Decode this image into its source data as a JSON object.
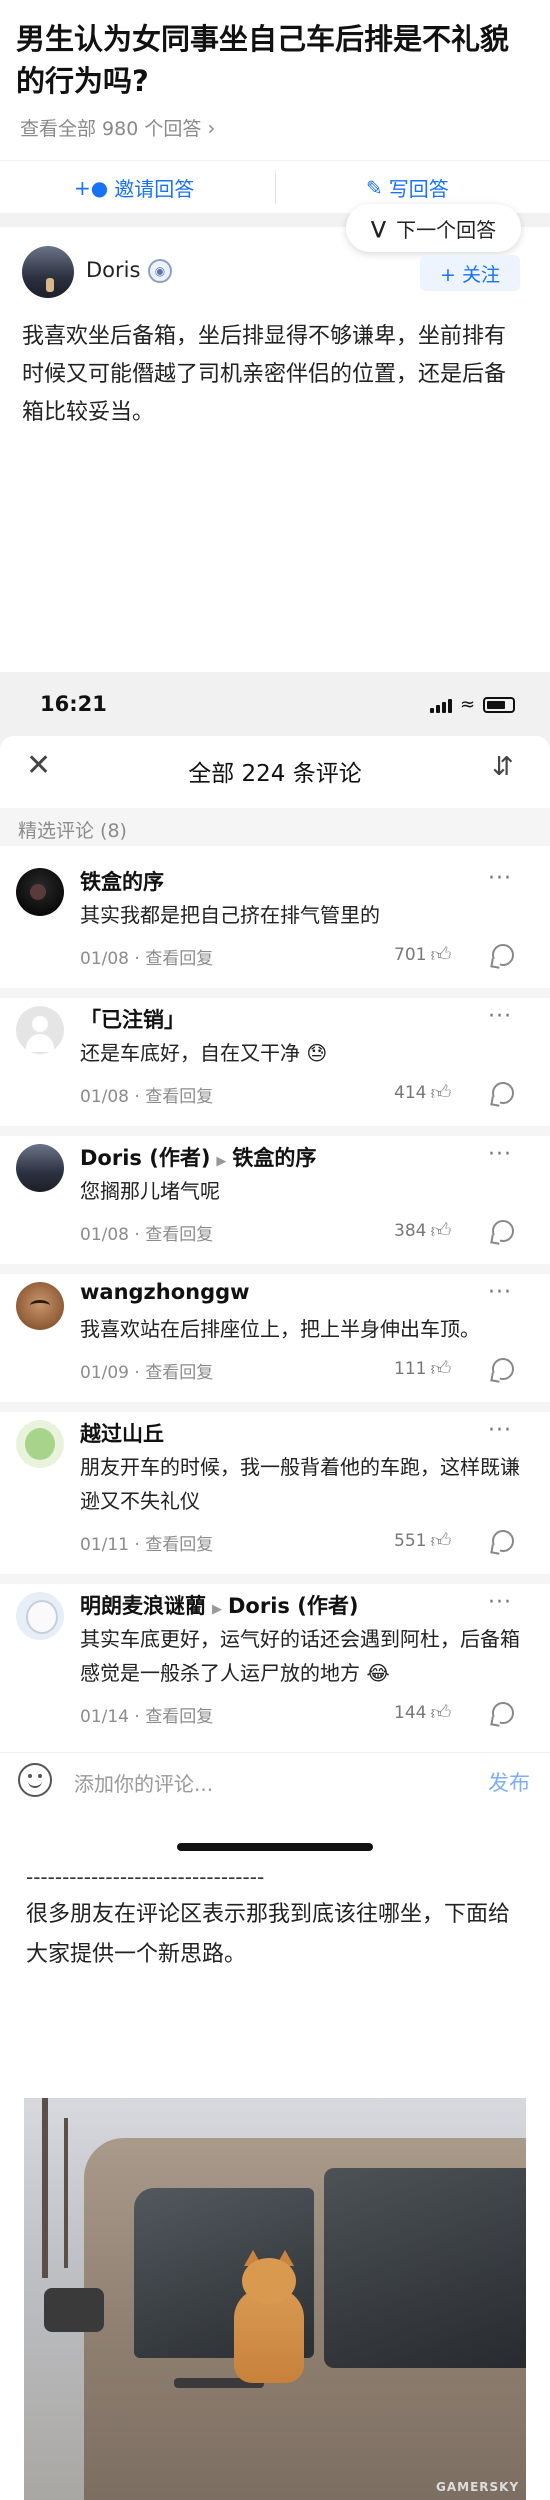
{
  "question": {
    "title": "男生认为女同事坐自己车后排是不礼貌的行为吗?",
    "view_all": "查看全部 980 个回答",
    "invite_label": "邀请回答",
    "write_label": "写回答",
    "next_answer_label": "下一个回答"
  },
  "answer": {
    "author": "Doris",
    "follow_label": "+ 关注",
    "text": "我喜欢坐后备箱，坐后排显得不够谦卑，坐前排有时候又可能僭越了司机亲密伴侣的位置，还是后备箱比较妥当。"
  },
  "statusbar": {
    "time": "16:21"
  },
  "comments_panel": {
    "title": "全部 224 条评论",
    "section_label": "精选评论 (8)",
    "reply_label": "查看回复",
    "comments": [
      {
        "author": "铁盒的序",
        "reply_to": "",
        "text": "其实我都是把自己挤在排气管里的",
        "date": "01/08",
        "likes": "701"
      },
      {
        "author": "「已注销」",
        "reply_to": "",
        "text": "还是车底好，自在又干净 😓",
        "date": "01/08",
        "likes": "414"
      },
      {
        "author": "Doris (作者)",
        "reply_to": "铁盒的序",
        "text": "您搁那儿堵气呢",
        "date": "01/08",
        "likes": "384"
      },
      {
        "author": "wangzhonggw",
        "reply_to": "",
        "text": "我喜欢站在后排座位上，把上半身伸出车顶。",
        "date": "01/09",
        "likes": "111"
      },
      {
        "author": "越过山丘",
        "reply_to": "",
        "text": "朋友开车的时候，我一般背着他的车跑，这样既谦逊又不失礼仪",
        "date": "01/11",
        "likes": "551"
      },
      {
        "author": "明朗麦浪谜藺",
        "reply_to": "Doris (作者)",
        "text": "其实车底更好，运气好的话还会遇到阿杜，后备箱感觉是一般杀了人运尸放的地方 😂",
        "date": "01/14",
        "likes": "144"
      }
    ],
    "input_placeholder": "添加你的评论...",
    "send_label": "发布"
  },
  "footer": {
    "dashes": "---------------------------------",
    "text": "很多朋友在评论区表示那我到底该往哪坐，下面给大家提供一个新思路。",
    "watermark": "GAMERSKY"
  },
  "colors": {
    "accent": "#1772f6",
    "send_disabled": "#7eaef5",
    "muted": "#8c8c8c"
  },
  "icons": {
    "invite": "person-plus-icon",
    "write": "edit-icon",
    "next": "double-chevron-down-icon",
    "close": "close-icon",
    "sort": "sort-icon",
    "like": "thumb-up-icon",
    "reply": "comment-bubble-icon",
    "more": "more-dots-icon",
    "emoji": "emoji-icon"
  }
}
